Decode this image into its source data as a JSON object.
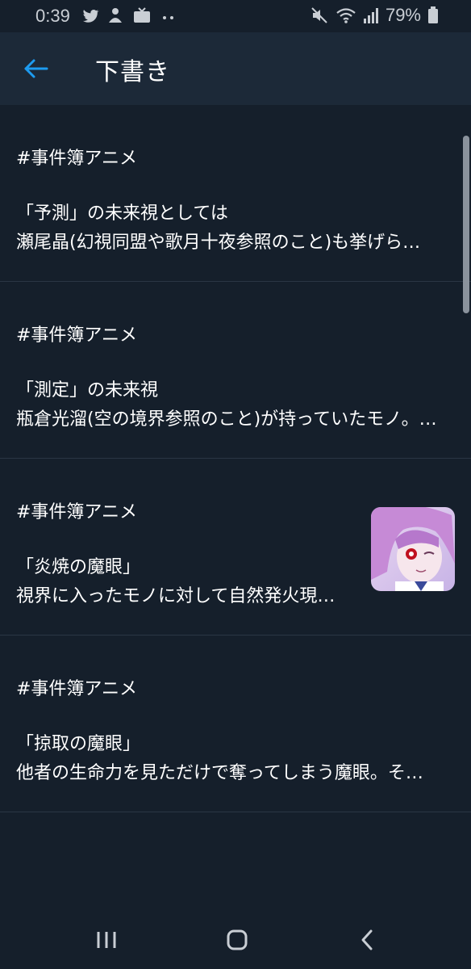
{
  "status_bar": {
    "time": "0:39",
    "battery": "79%",
    "left_icons": [
      "twitter-icon",
      "notification-icon",
      "tv-icon",
      "more-dots-icon"
    ],
    "right_icons": [
      "mute-icon",
      "wifi-icon",
      "signal-icon",
      "battery-icon"
    ]
  },
  "app_bar": {
    "title": "下書き",
    "accent_color": "#1d9bf0"
  },
  "drafts": [
    {
      "hashtag": "#事件簿アニメ",
      "line1": "「予測」の未来視としては",
      "line2": "瀬尾晶(幻視同盟や歌月十夜参照のこと)も挙げら…",
      "has_thumbnail": false
    },
    {
      "hashtag": "#事件簿アニメ",
      "line1": "「測定」の未来視",
      "line2": "瓶倉光溜(空の境界参照のこと)が持っていたモノ。…",
      "has_thumbnail": false
    },
    {
      "hashtag": "#事件簿アニメ",
      "line1": "「炎焼の魔眼」",
      "line2": "視界に入ったモノに対して自然発火現…",
      "has_thumbnail": true
    },
    {
      "hashtag": "#事件簿アニメ",
      "line1": "「掠取の魔眼」",
      "line2": "他者の生命力を見ただけで奪ってしまう魔眼。そ…",
      "has_thumbnail": false
    }
  ],
  "nav_bar": {
    "buttons": [
      "recent-apps-icon",
      "home-icon",
      "back-nav-icon"
    ]
  }
}
